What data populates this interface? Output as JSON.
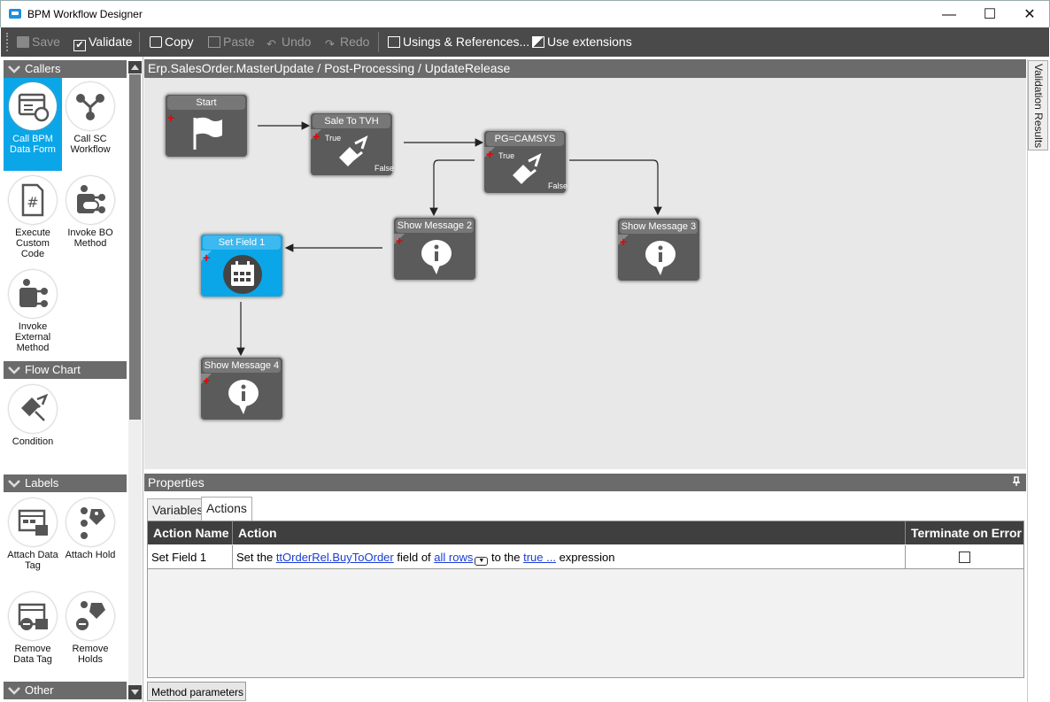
{
  "window": {
    "title": "BPM Workflow Designer",
    "minimize": "—",
    "maximize": "☐",
    "close": "✕"
  },
  "toolbar": {
    "save": "Save",
    "validate": "Validate",
    "copy": "Copy",
    "paste": "Paste",
    "undo": "Undo",
    "redo": "Redo",
    "usings": "Usings & References...",
    "extensions": "Use extensions"
  },
  "toolbox": {
    "callers": {
      "header": "Callers",
      "items": [
        "Call BPM Data Form",
        "Call SC Workflow",
        "Execute Custom Code",
        "Invoke BO Method",
        "Invoke External Method"
      ]
    },
    "flow": {
      "header": "Flow Chart",
      "items": [
        "Condition"
      ]
    },
    "labels": {
      "header": "Labels",
      "items": [
        "Attach Data Tag",
        "Attach Hold",
        "Remove Data Tag",
        "Remove Holds"
      ]
    },
    "other": {
      "header": "Other"
    }
  },
  "breadcrumb": "Erp.SalesOrder.MasterUpdate / Post-Processing / UpdateRelease",
  "nodes": {
    "start": {
      "label": "Start"
    },
    "sale": {
      "label": "Sale To TVH",
      "true": "True",
      "false": "False"
    },
    "pg": {
      "label": "PG=CAMSYS",
      "true": "True",
      "false": "False"
    },
    "msg2": {
      "label": "Show Message 2"
    },
    "msg3": {
      "label": "Show Message 3"
    },
    "set1": {
      "label": "Set Field 1"
    },
    "msg4": {
      "label": "Show Message 4"
    }
  },
  "properties": {
    "title": "Properties",
    "tabs": [
      "Variables",
      "Actions"
    ],
    "active_tab": "Actions",
    "columns": [
      "Action Name",
      "Action",
      "Terminate on Error"
    ],
    "row": {
      "name": "Set Field 1",
      "t1": "Set the ",
      "field": "ttOrderRel.BuyToOrder",
      "t2": " field of ",
      "rows": "all rows",
      "t3": " to the ",
      "expr": " true ...",
      "t4": " expression"
    },
    "bottom_tab": "Method parameters"
  },
  "right_panel": {
    "validation_tab": "Validation Results"
  },
  "colors": {
    "accent": "#0aa6e8",
    "toolbar": "#4a4a4a",
    "header": "#6b6b6b"
  }
}
